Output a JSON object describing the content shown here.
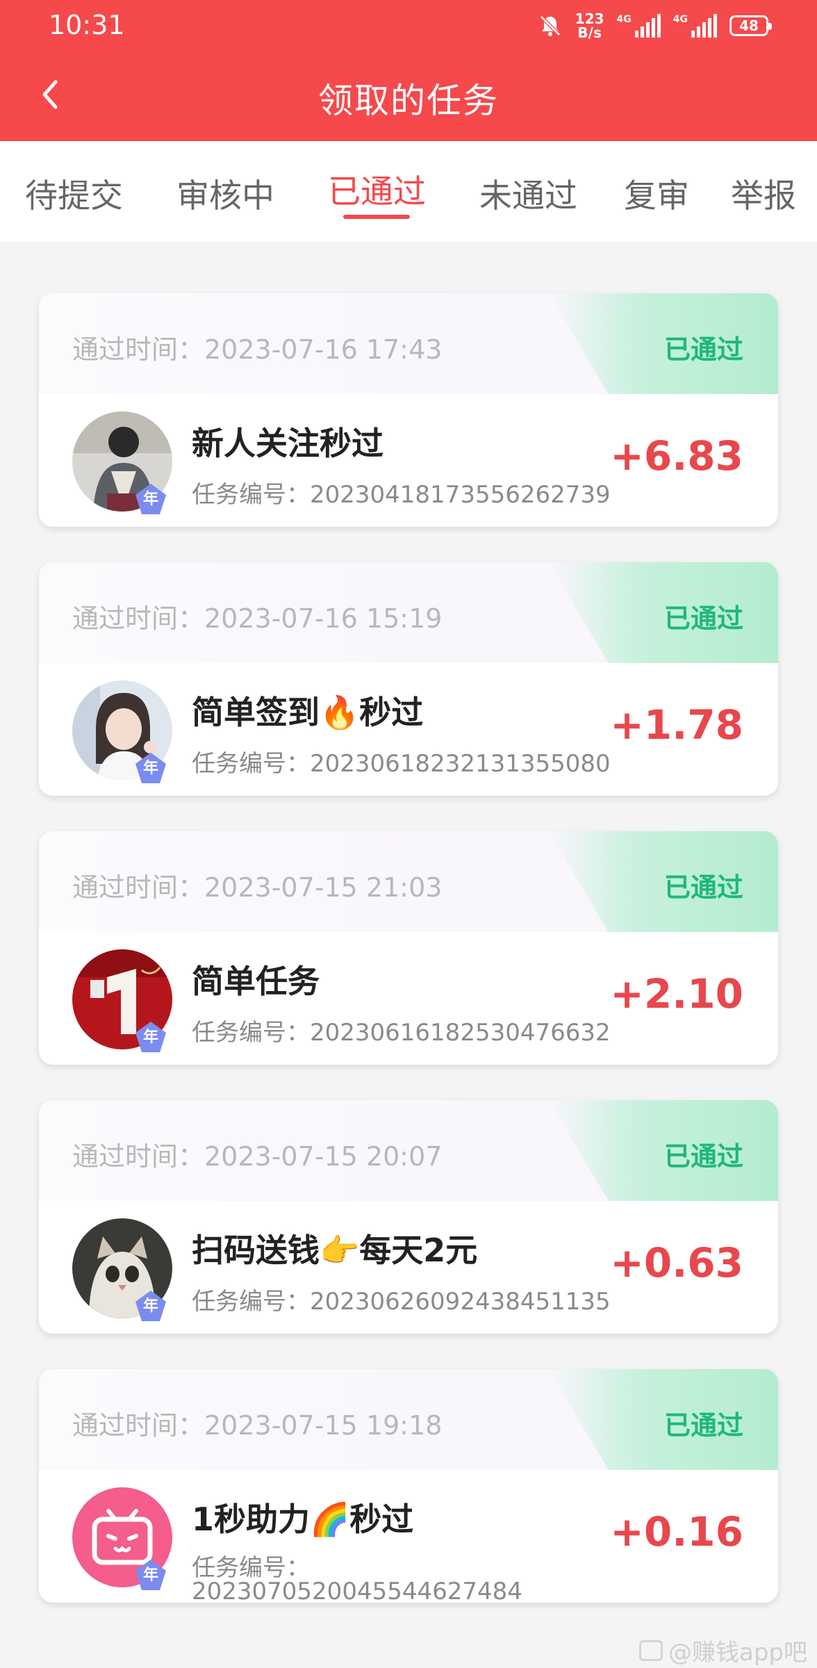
{
  "status_bar": {
    "time": "10:31",
    "speed_top": "123",
    "speed_bottom": "B/s",
    "sim1_tag": "4G",
    "sim2_tag": "4G",
    "battery": "48"
  },
  "header": {
    "title": "领取的任务",
    "back_icon": "chevron-left-icon"
  },
  "tabs": [
    {
      "label": "待提交"
    },
    {
      "label": "审核中"
    },
    {
      "label": "已通过",
      "active": true
    },
    {
      "label": "未通过"
    },
    {
      "label": "复审"
    },
    {
      "label": "举报"
    }
  ],
  "tasks": [
    {
      "pass_time": "通过时间：2023-07-16 17:43",
      "status": "已通过",
      "title": "新人关注秒过",
      "task_no": "任务编号：2023041817355626273​9",
      "amount": "+6.83",
      "badge": "年"
    },
    {
      "pass_time": "通过时间：2023-07-16 15:19",
      "status": "已通过",
      "title": "简单签到🔥秒过",
      "task_no": "任务编号：20230618232131355080",
      "amount": "+1.78",
      "badge": "年"
    },
    {
      "pass_time": "通过时间：2023-07-15 21:03",
      "status": "已通过",
      "title": "简单任务",
      "task_no": "任务编号：20230616182530476632",
      "amount": "+2.10",
      "badge": "年"
    },
    {
      "pass_time": "通过时间：2023-07-15 20:07",
      "status": "已通过",
      "title": "扫码送钱👉每天2元",
      "task_no": "任务编号：20230626092438451135",
      "amount": "+0.63",
      "badge": "年"
    },
    {
      "pass_time": "通过时间：2023-07-15 19:18",
      "status": "已通过",
      "title": "1秒助力🌈秒过",
      "task_no_label": "任务编号：",
      "task_no_value": "20230705200455446274​84",
      "amount": "+0.16",
      "badge": "年"
    }
  ],
  "watermark": "@赚钱app吧"
}
